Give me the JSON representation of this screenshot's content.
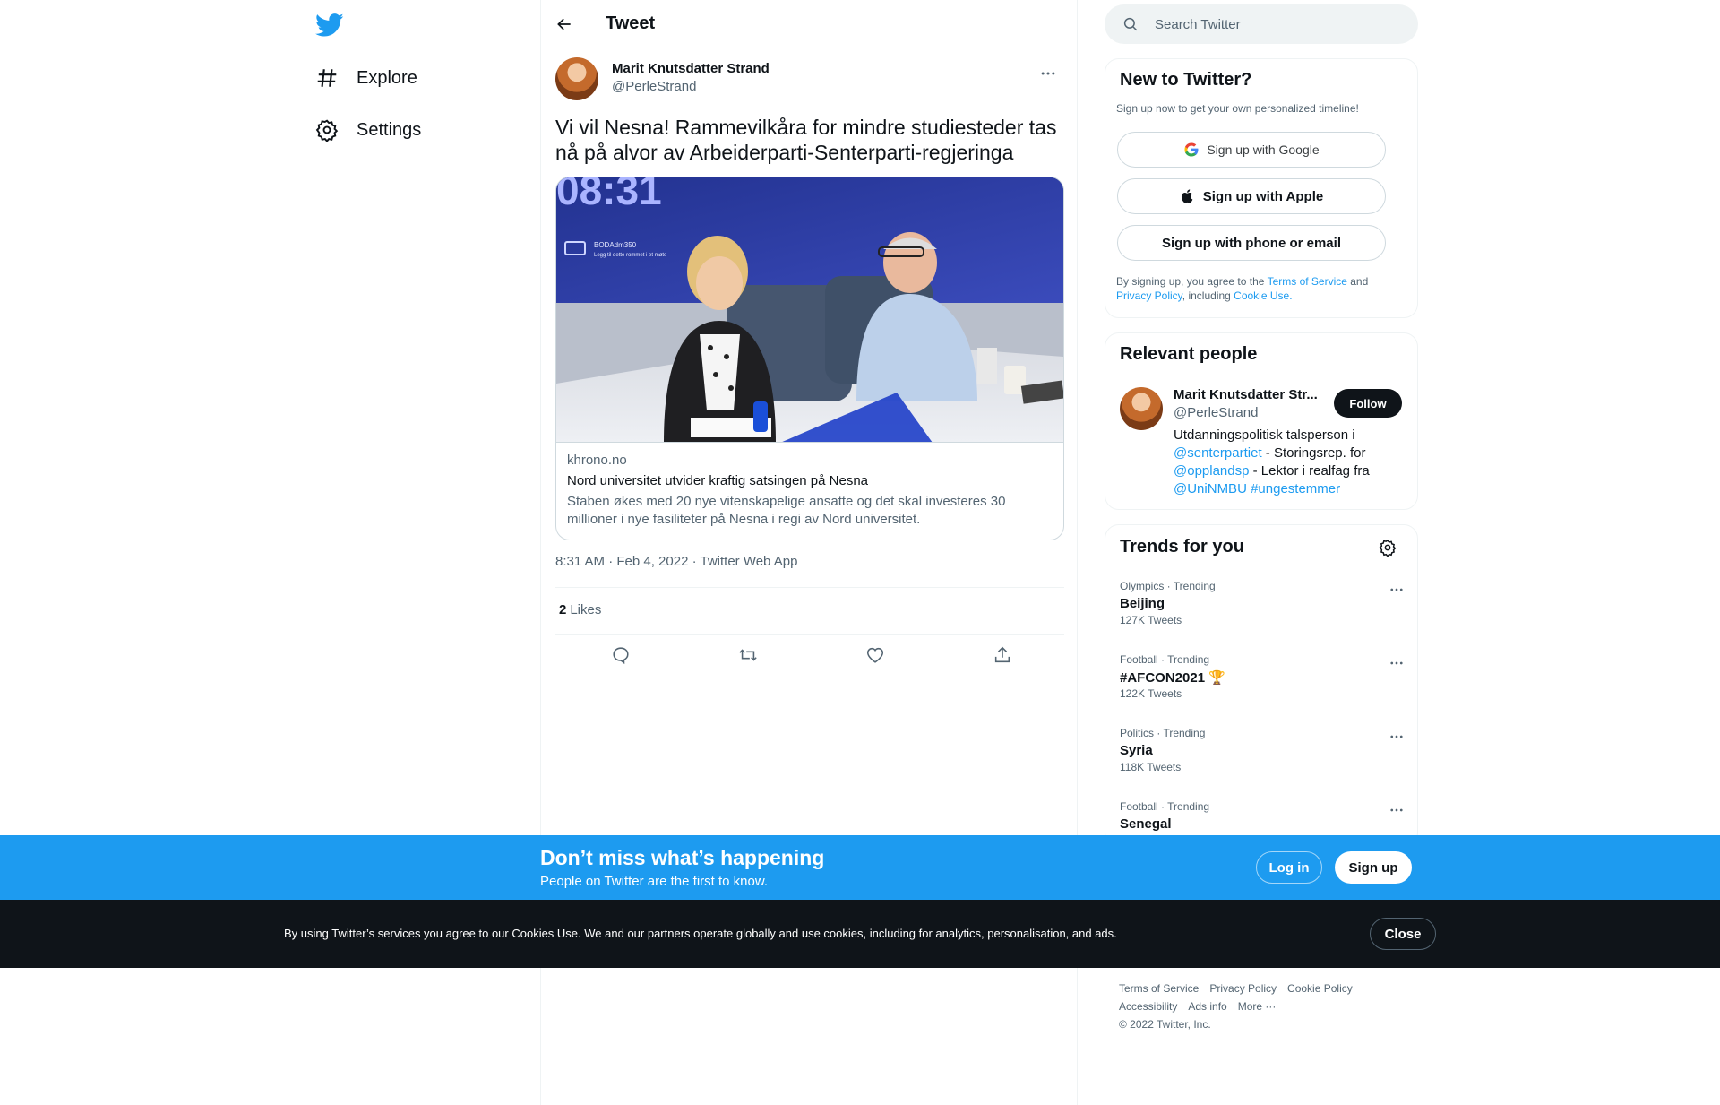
{
  "nav": {
    "explore_label": "Explore",
    "settings_label": "Settings"
  },
  "header": {
    "title": "Tweet"
  },
  "tweet": {
    "author_name": "Marit Knutsdatter Strand",
    "author_handle": "@PerleStrand",
    "text": "Vi vil Nesna! Rammevilkåra for mindre studiesteder tas nå på alvor av Arbeiderparti-Senterparti-regjeringa",
    "card": {
      "domain": "khrono.no",
      "title": "Nord universitet utvider kraftig satsingen på Nesna",
      "description": "Staben økes med 20 nye vitenskapelige ansatte og det skal investeres 30 millioner i nye fasiliteter på Nesna i regi av Nord universitet.",
      "image_screen_time": "08:31",
      "image_screen_room": "BODAdm350",
      "image_screen_sub": "Legg til dette rommet i et møte"
    },
    "timestamp": "8:31 AM · Feb 4, 2022 · Twitter Web App",
    "likes_count": "2",
    "likes_label": "Likes"
  },
  "search": {
    "placeholder": "Search Twitter"
  },
  "new_to_twitter": {
    "title": "New to Twitter?",
    "subtitle": "Sign up now to get your own personalized timeline!",
    "google_label": "Sign up with Google",
    "apple_label": "Sign up with Apple",
    "email_label": "Sign up with phone or email",
    "terms_prefix": "By signing up, you agree to the ",
    "terms_link": "Terms of Service",
    "terms_and": " and",
    "privacy_link": "Privacy Policy",
    "including": ", including ",
    "cookie_link": "Cookie Use."
  },
  "relevant_people": {
    "title": "Relevant people",
    "name": "Marit Knutsdatter Str...",
    "handle": "@PerleStrand",
    "follow_label": "Follow",
    "bio_1": "Utdanningspolitisk talsperson i",
    "bio_link_1": "@senterpartiet",
    "bio_2": " - Storingsrep. for",
    "bio_link_2": "@opplandsp",
    "bio_3": " - Lektor i realfag fra",
    "bio_link_3": "@UniNMBU",
    "bio_link_4": "#ungestemmer"
  },
  "trends": {
    "title": "Trends for you",
    "items": [
      {
        "meta": "Olympics · Trending",
        "name": "Beijing",
        "count": "127K Tweets"
      },
      {
        "meta": "Football · Trending",
        "name": "#AFCON2021 🏆",
        "count": "122K Tweets"
      },
      {
        "meta": "Politics · Trending",
        "name": "Syria",
        "count": "118K Tweets"
      },
      {
        "meta": "Football · Trending",
        "name": "Senegal",
        "count": ""
      }
    ]
  },
  "footer": {
    "terms": "Terms of Service",
    "privacy": "Privacy Policy",
    "cookie": "Cookie Policy",
    "accessibility": "Accessibility",
    "ads": "Ads info",
    "more": "More ···",
    "copyright": "© 2022 Twitter, Inc."
  },
  "promo": {
    "title": "Don’t miss what’s happening",
    "subtitle": "People on Twitter are the first to know.",
    "login_label": "Log in",
    "signup_label": "Sign up"
  },
  "cookie_banner": {
    "text": "By using Twitter’s services you agree to our Cookies Use. We and our partners operate globally and use cookies, including for analytics, personalisation, and ads.",
    "close_label": "Close"
  },
  "colors": {
    "brand": "#1d9bf0",
    "text": "#0f1419",
    "muted": "#536471",
    "cookie_bg": "#0f1419"
  }
}
